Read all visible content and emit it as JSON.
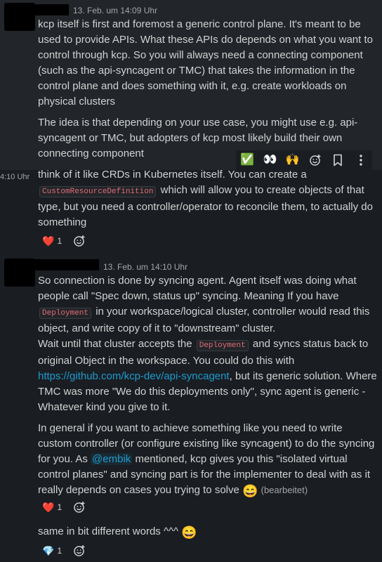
{
  "messages": [
    {
      "timestamp": "13. Feb. um 14:09 Uhr",
      "paragraphs": [
        "kcp itself is first and foremost a generic control plane. It's meant to be used to provide APIs. What these APIs do depends on what you want to control through kcp. So you will always need a connecting component (such as the api-syncagent or TMC) that takes the information in the control plane and does something with it, e.g. create workloads on physical clusters",
        "The idea is that depending on your use case, you might use e.g. api-syncagent or TMC, but adopters of kcp most likely build their own connecting component"
      ]
    },
    {
      "side_time": "4:10 Uhr",
      "text_before": "think of it like CRDs in Kubernetes itself. You can create a",
      "code": "CustomResourceDefinition",
      "text_after": "which will allow you to create objects of that type, but you need a controller/operator to reconcile them, to actually do something",
      "reaction_emoji": "❤️",
      "reaction_count": "1"
    },
    {
      "timestamp": "13. Feb. um 14:10 Uhr",
      "p1_a": "So connection is done by syncing agent. Agent itself was doing what people call \"Spec down, status up\" syncing. Meaning If you have",
      "p1_code": "Deployment",
      "p1_b": "in your workspace/logical cluster, controller would read this object, and write copy of it to \"downstream\" cluster.",
      "p2_a": "Wait until that cluster accepts the",
      "p2_code": "Deployment",
      "p2_b": "and syncs status back to original Object in the workspace. You could do this with",
      "p2_link": "https://github.com/kcp-dev/api-syncagent",
      "p2_c": ", but its generic solution. Where TMC was more \"We do this deployments only\", sync agent is generic - Whatever kind you give to it.",
      "p3_a": "In general if you want to achieve something like you need to write custom controller (or configure existing like syncagent) to do the syncing for you. As",
      "p3_mention": "@embik",
      "p3_b": "mentioned, kcp gives you this \"isolated virtual control planes\" and syncing part is for the implementer to deal with as it really depends on cases you trying to solve",
      "p3_emoji": "😄",
      "edited": "(bearbeitet)",
      "reaction_emoji": "❤️",
      "reaction_count": "1"
    },
    {
      "text": "same in bit different words ^^^",
      "emoji": "😄",
      "reaction_emoji": "💎",
      "reaction_count": "1"
    }
  ],
  "toolbar": {
    "items": [
      "✅",
      "👀",
      "🙌",
      "add-reaction-icon",
      "bookmark-icon",
      "more-icon"
    ]
  },
  "colors": {
    "background": "#1a1d21",
    "text": "#d1d2d3",
    "link": "#1d9bd1",
    "code": "#e8912d"
  }
}
